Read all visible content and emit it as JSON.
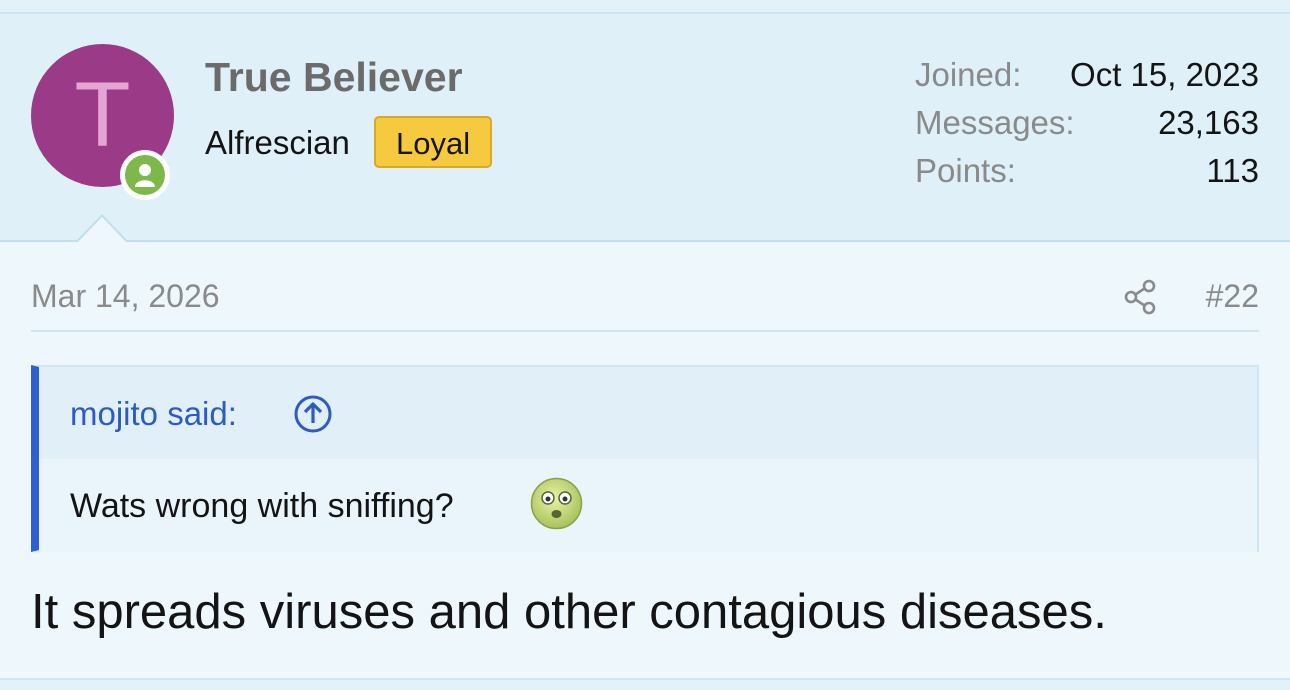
{
  "user": {
    "avatar_letter": "T",
    "username": "True Believer",
    "title": "Alfrescian",
    "badge": "Loyal",
    "online_icon": "user-online-icon",
    "stats": [
      {
        "label": "Joined:",
        "value": "Oct 15, 2023"
      },
      {
        "label": "Messages:",
        "value": "23,163"
      },
      {
        "label": "Points:",
        "value": "113"
      }
    ]
  },
  "post": {
    "date": "Mar 14, 2026",
    "share_icon": "share-icon",
    "number": "#22"
  },
  "quote": {
    "author": "mojito said:",
    "jump_icon": "arrow-up-circle-icon",
    "text": "Wats wrong with sniffing?",
    "smilie_icon": "sick-face-icon"
  },
  "message": {
    "text": "It spreads viruses and other contagious diseases."
  },
  "colors": {
    "avatar_bg": "#9b3a86",
    "online_green": "#7eb84a",
    "badge_yellow": "#f6ca3f",
    "quote_accent": "#2f5fd0",
    "link_blue": "#2d5bbf"
  }
}
